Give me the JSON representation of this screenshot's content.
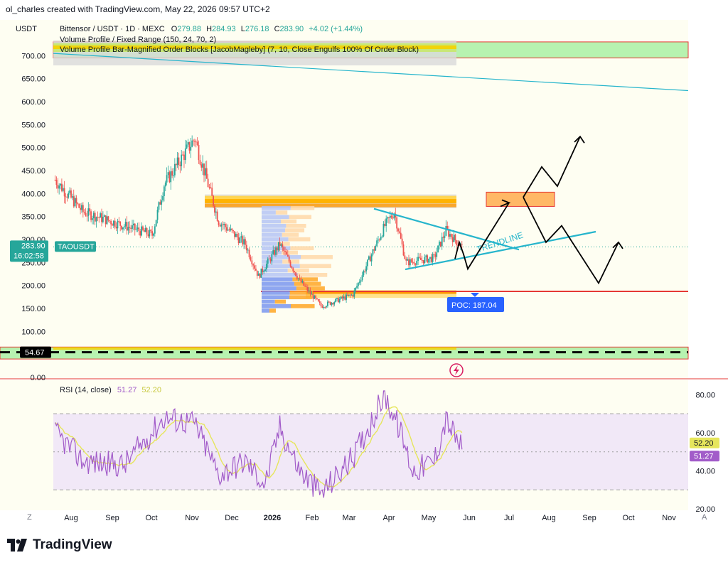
{
  "caption": "ol_charles created with TradingView.com, May 22, 2026 09:57 UTC+2",
  "brand": "TradingView",
  "colors": {
    "bg": "#fefef2",
    "up": "#26a69a",
    "down": "#ef5350",
    "trend": "#26b5cc",
    "rsi": "#a25cc9",
    "rsi_ma": "#e6e65c",
    "poc": "#2962ff",
    "zone_green": "#b7f2b0",
    "order_block": "#ffb866",
    "support": "#e53935"
  },
  "chart_data": [
    {
      "type": "candlestick",
      "title": "Bittensor / USDT · 1D · MEXC",
      "currency": "USDT",
      "ohlc_header": {
        "o_label": "O",
        "o": "279.88",
        "h_label": "H",
        "h": "284.93",
        "l_label": "L",
        "l": "276.18",
        "c_label": "C",
        "c": "283.90",
        "change": "+4.02 (+1.44%)"
      },
      "indicators": [
        "Volume Profile / Fixed Range (150, 24, 70, 2)",
        "Volume Profile Bar-Magnified Order Blocks [JacobMagleby] (7, 10, Close Engulfs 100% Of Order Block)"
      ],
      "ylim": [
        0,
        750
      ],
      "y_ticks": [
        "0.00",
        "100.00",
        "150.00",
        "200.00",
        "250.00",
        "300.00",
        "350.00",
        "400.00",
        "450.00",
        "500.00",
        "550.00",
        "600.00",
        "650.00",
        "700.00"
      ],
      "x_ticks": [
        "Aug",
        "Sep",
        "Oct",
        "Nov",
        "Dec",
        "2026",
        "Feb",
        "Mar",
        "Apr",
        "May",
        "Jun",
        "Jul",
        "Aug",
        "Sep",
        "Oct",
        "Nov"
      ],
      "price_label": {
        "symbol": "TAOUSDT",
        "price": "283.90",
        "countdown": "16:02:58"
      },
      "level_label": "54.67",
      "poc_label": "POC: 187.04",
      "trendline_label": "TRENDLINE",
      "grid": false,
      "key_points": [
        {
          "date": "2025-07-20",
          "close": 430
        },
        {
          "date": "2025-08-10",
          "close": 360
        },
        {
          "date": "2025-09-10",
          "close": 330
        },
        {
          "date": "2025-10-01",
          "close": 310
        },
        {
          "date": "2025-10-10",
          "close": 420
        },
        {
          "date": "2025-11-02",
          "close": 520
        },
        {
          "date": "2025-11-20",
          "close": 340
        },
        {
          "date": "2025-12-10",
          "close": 290
        },
        {
          "date": "2025-12-20",
          "close": 220
        },
        {
          "date": "2026-01-05",
          "close": 290
        },
        {
          "date": "2026-01-20",
          "close": 210
        },
        {
          "date": "2026-02-05",
          "close": 155
        },
        {
          "date": "2026-03-01",
          "close": 180
        },
        {
          "date": "2026-03-25",
          "close": 330
        },
        {
          "date": "2026-04-01",
          "close": 360
        },
        {
          "date": "2026-04-10",
          "close": 250
        },
        {
          "date": "2026-05-01",
          "close": 260
        },
        {
          "date": "2026-05-10",
          "close": 320
        },
        {
          "date": "2026-05-22",
          "close": 283.9
        }
      ]
    },
    {
      "type": "line",
      "title": "RSI (14, close)",
      "series": [
        {
          "name": "RSI",
          "value_label": "51.27"
        },
        {
          "name": "MA",
          "value_label": "52.20"
        }
      ],
      "ylim": [
        20,
        85
      ],
      "y_ticks": [
        "20.00",
        "40.00",
        "60.00",
        "80.00"
      ],
      "bands": [
        30,
        70
      ],
      "key_points": [
        {
          "date": "2025-07-20",
          "value": 60
        },
        {
          "date": "2025-08-10",
          "value": 45
        },
        {
          "date": "2025-09-10",
          "value": 43
        },
        {
          "date": "2025-10-10",
          "value": 68
        },
        {
          "date": "2025-11-02",
          "value": 65
        },
        {
          "date": "2025-11-20",
          "value": 38
        },
        {
          "date": "2025-12-10",
          "value": 45
        },
        {
          "date": "2025-12-25",
          "value": 33
        },
        {
          "date": "2026-01-05",
          "value": 63
        },
        {
          "date": "2026-01-20",
          "value": 40
        },
        {
          "date": "2026-02-05",
          "value": 28
        },
        {
          "date": "2026-03-01",
          "value": 47
        },
        {
          "date": "2026-03-25",
          "value": 80
        },
        {
          "date": "2026-04-05",
          "value": 62
        },
        {
          "date": "2026-04-15",
          "value": 40
        },
        {
          "date": "2026-05-01",
          "value": 45
        },
        {
          "date": "2026-05-10",
          "value": 67
        },
        {
          "date": "2026-05-22",
          "value": 51.27
        }
      ]
    }
  ],
  "x_nav": {
    "left": "Z",
    "right": "A"
  }
}
